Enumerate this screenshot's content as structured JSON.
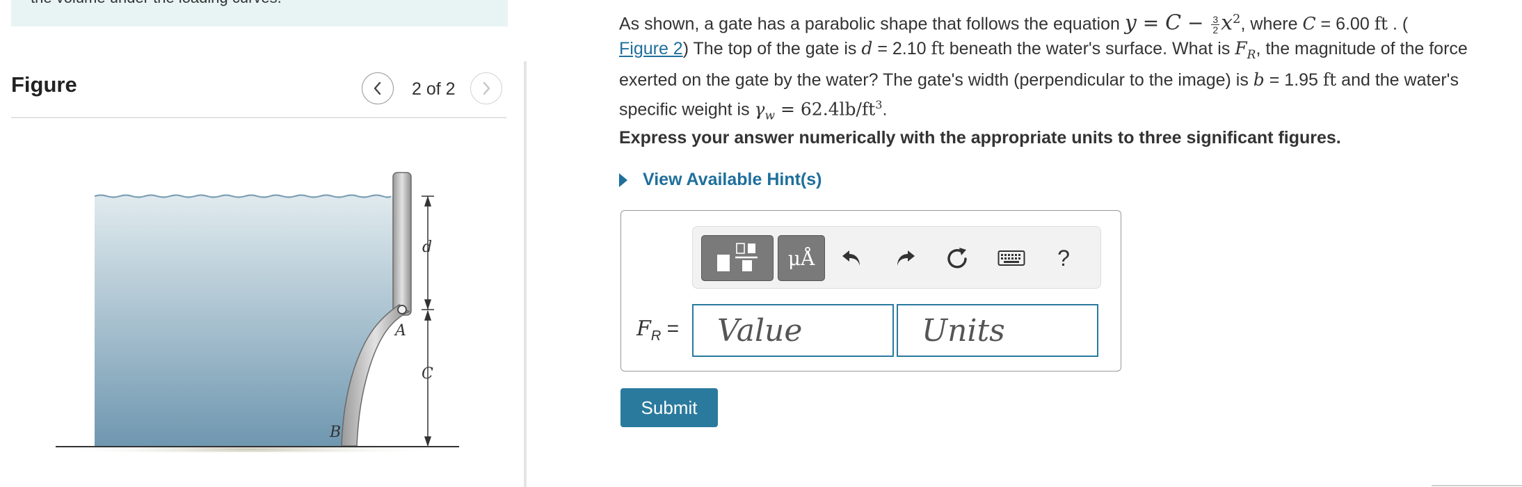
{
  "left": {
    "top_note": "the volume under the loading curves.",
    "figure_title": "Figure",
    "nav": {
      "prev_label": "<",
      "next_label": ">",
      "counter": "2 of 2"
    },
    "diagram_labels": {
      "d": "d",
      "A": "A",
      "C": "C",
      "B": "B"
    }
  },
  "problem": {
    "p1": "As shown, a gate has a parabolic shape that follows the equation ",
    "eq_y": "y",
    "eq_eq": " = ",
    "eq_C": "C",
    "eq_minus": " − ",
    "frac_num": "3",
    "frac_den": "2",
    "eq_x": "x",
    "eq_pow": "2",
    "p2": ", where ",
    "c_sym": "C",
    "c_val": " = 6.00 ",
    "c_unit": "ft",
    "p3": " . (",
    "fig_link": "Figure 2",
    "p4": ") The top of the gate is ",
    "d_sym": "d",
    "d_val": " = 2.10 ",
    "d_unit": "ft",
    "p5": " beneath the water's surface. What is ",
    "fr_sym": "F",
    "fr_sub": "R",
    "p6": ", the magnitude of the force exerted on the gate by the water? The gate's width (perpendicular to the image) is ",
    "b_sym": "b",
    "b_val": " = 1.95 ",
    "b_unit": "ft",
    "p7": " and the water's specific weight is ",
    "gw_sym": "γ",
    "gw_sub": "w",
    "gw_val": " = 62.4lb/ft",
    "gw_pow": "3",
    "p8": "."
  },
  "instruction": "Express your answer numerically with the appropriate units to three significant figures.",
  "hints_label": "View Available Hint(s)",
  "toolbar": {
    "units_label": "μÅ",
    "help_label": "?"
  },
  "answer": {
    "label_main": "F",
    "label_sub": "R",
    "label_eq": " =",
    "value_placeholder": "Value",
    "units_placeholder": "Units"
  },
  "submit_label": "Submit",
  "colors": {
    "accent": "#2a7a9e",
    "link": "#1f6f9b",
    "water_top": "#dfe8ec",
    "water_bottom": "#6d95ae"
  }
}
